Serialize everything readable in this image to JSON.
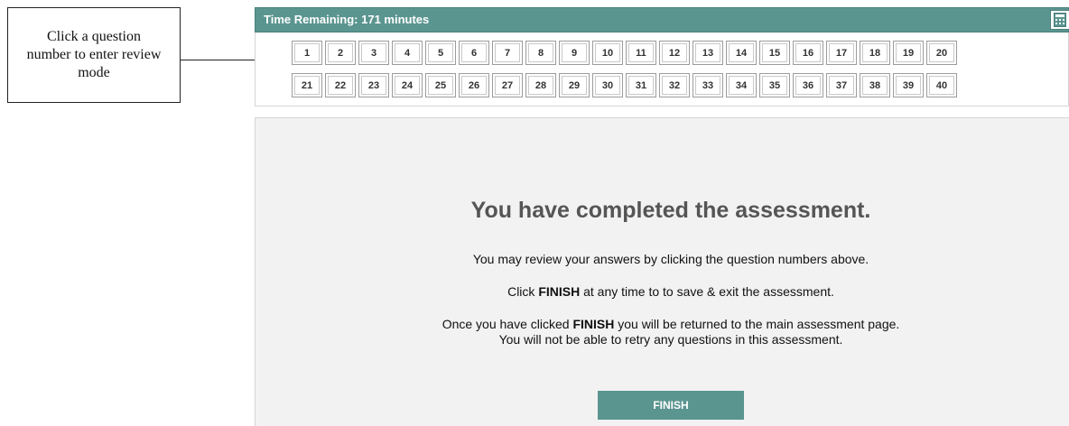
{
  "callout": {
    "text": "Click a question number to enter review mode"
  },
  "header": {
    "time_remaining": "Time Remaining: 171 minutes",
    "calculator_icon": "calculator-icon"
  },
  "questions": {
    "row1": [
      "1",
      "2",
      "3",
      "4",
      "5",
      "6",
      "7",
      "8",
      "9",
      "10",
      "11",
      "12",
      "13",
      "14",
      "15",
      "16",
      "17",
      "18",
      "19",
      "20"
    ],
    "row2": [
      "21",
      "22",
      "23",
      "24",
      "25",
      "26",
      "27",
      "28",
      "29",
      "30",
      "31",
      "32",
      "33",
      "34",
      "35",
      "36",
      "37",
      "38",
      "39",
      "40"
    ]
  },
  "completion": {
    "title": "You have completed the assessment.",
    "review_text": "You may review your answers by clicking the question numbers above.",
    "click_prefix": "Click ",
    "click_keyword": "FINISH",
    "click_suffix": " at any time to to save & exit the assessment.",
    "once_prefix": "Once you have clicked ",
    "once_keyword": "FINISH",
    "once_suffix": " you will be returned to the main assessment page.",
    "retry_text": "You will not be able to retry any questions in this assessment.",
    "finish_label": "FINISH"
  },
  "colors": {
    "accent": "#5b9590",
    "panel_bg": "#f2f2f2",
    "title_gray": "#555555"
  }
}
